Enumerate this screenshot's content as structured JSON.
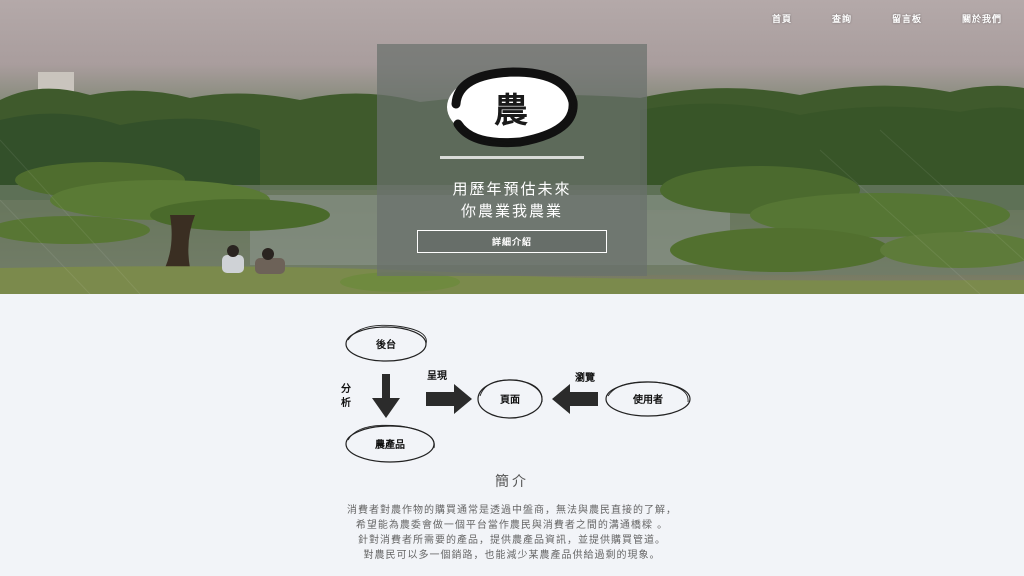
{
  "nav": {
    "items": [
      {
        "label": "首頁"
      },
      {
        "label": "查詢"
      },
      {
        "label": "留言板"
      },
      {
        "label": "關於我們"
      }
    ]
  },
  "hero": {
    "logo_char": "農",
    "slogan_line1": "用歷年預估未來",
    "slogan_line2": "你農業我農業",
    "detail_button": "詳細介紹"
  },
  "diagram": {
    "backend": "後台",
    "analyze_char1": "分",
    "analyze_char2": "析",
    "present": "呈現",
    "page": "頁面",
    "browse": "瀏覽",
    "user": "使用者",
    "products": "農產品"
  },
  "intro": {
    "title": "簡介",
    "lines": [
      "消費者對農作物的購買通常是透過中盤商，無法與農民直接的了解，",
      "希望能為農委會做一個平台當作農民與消費者之間的溝通橋樑 。",
      "針對消費者所需要的產品，提供農產品資訊，並提供購買管道。",
      "對農民可以多一個銷路，也能減少某農產品供給過剩的現象。"
    ]
  },
  "colors": {
    "page_background": "#f2f4f8",
    "panel_overlay": "#69706c",
    "text_dark": "#111111"
  }
}
